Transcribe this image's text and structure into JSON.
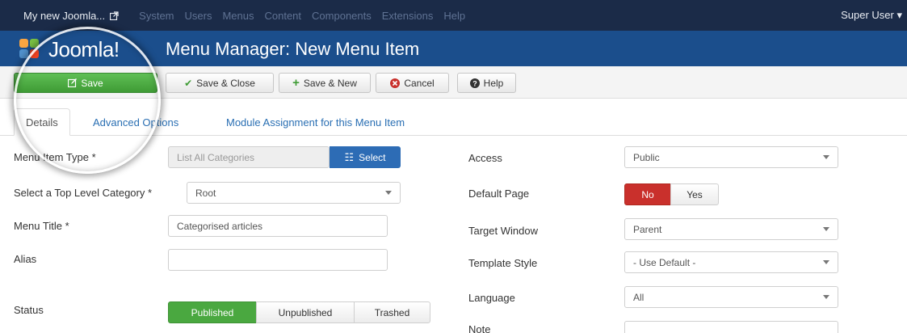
{
  "topbar": {
    "site_label": "My new Joomla...",
    "nav": [
      "System",
      "Users",
      "Menus",
      "Content",
      "Components",
      "Extensions",
      "Help"
    ],
    "user_label": "Super User"
  },
  "header": {
    "logo_text": "Joomla!",
    "page_title": "Menu Manager: New Menu Item"
  },
  "toolbar": {
    "save": "Save",
    "save_close": "Save & Close",
    "save_new": "Save & New",
    "cancel": "Cancel",
    "help": "Help"
  },
  "tabs": [
    "Details",
    "Advanced Options",
    "Module Assignment for this Menu Item"
  ],
  "form_left": {
    "menu_item_type_label": "Menu Item Type *",
    "menu_item_type_value": "List All Categories",
    "select_button": "Select",
    "top_level_label": "Select a Top Level Category *",
    "top_level_value": "Root",
    "menu_title_label": "Menu Title *",
    "menu_title_value": "Categorised articles",
    "alias_label": "Alias",
    "alias_value": "",
    "status_label": "Status",
    "status_options": [
      "Published",
      "Unpublished",
      "Trashed"
    ],
    "status_selected": "Published"
  },
  "form_right": {
    "access_label": "Access",
    "access_value": "Public",
    "default_page_label": "Default Page",
    "default_page_options": [
      "No",
      "Yes"
    ],
    "default_page_selected": "No",
    "target_window_label": "Target Window",
    "target_window_value": "Parent",
    "template_style_label": "Template Style",
    "template_style_value": "- Use Default -",
    "language_label": "Language",
    "language_value": "All",
    "note_label": "Note",
    "note_value": ""
  },
  "colors": {
    "topbar": "#1b2b48",
    "header": "#1b4e8c",
    "save_green": "#4aa840",
    "no_red": "#c9302c",
    "select_blue": "#2d6cb5"
  }
}
